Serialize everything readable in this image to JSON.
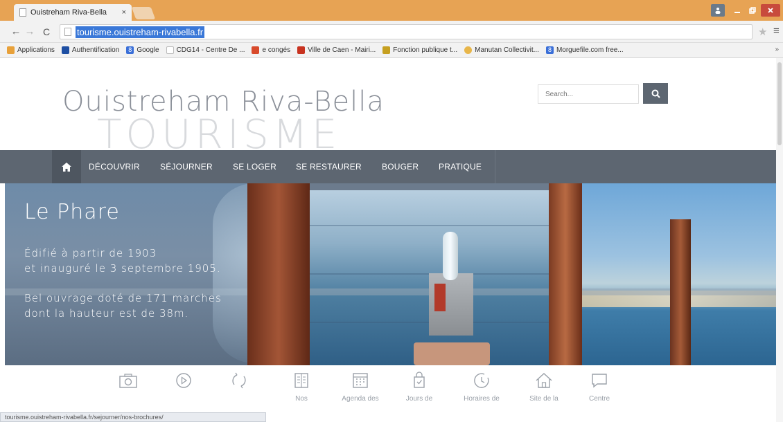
{
  "browser": {
    "tab_title": "Ouistreham Riva-Bella",
    "tab_close": "×",
    "url": "tourisme.ouistreham-rivabella.fr",
    "status_url": "tourisme.ouistreham-rivabella.fr/sejourner/nos-brochures/",
    "bookmarks": [
      {
        "label": "Applications",
        "icon": "apps-icon",
        "color": "#e8a13a"
      },
      {
        "label": "Authentification",
        "icon": "arrow-icon",
        "color": "#1e4fa3"
      },
      {
        "label": "Google",
        "icon": "google-icon",
        "color": "#3a6fd8"
      },
      {
        "label": "CDG14 - Centre De ...",
        "icon": "page-icon",
        "color": "#dddddd"
      },
      {
        "label": "e congés",
        "icon": "gem-icon",
        "color": "#d84a2b"
      },
      {
        "label": "Ville de Caen - Mairi...",
        "icon": "flame-icon",
        "color": "#c83320"
      },
      {
        "label": "Fonction publique t...",
        "icon": "g-icon",
        "color": "#c6a020"
      },
      {
        "label": "Manutan Collectivit...",
        "icon": "sun-icon",
        "color": "#e8b64a"
      },
      {
        "label": "Morguefile.com free...",
        "icon": "google-icon",
        "color": "#3a6fd8"
      }
    ],
    "bookmarks_more": "»"
  },
  "site": {
    "logo_line1": "Ouistreham Riva-Bella",
    "logo_line2": "TOURISME",
    "search_placeholder": "Search..."
  },
  "nav": {
    "items": [
      "DÉCOUVRIR",
      "SÉJOURNER",
      "SE LOGER",
      "SE RESTAURER",
      "BOUGER",
      "PRATIQUE"
    ]
  },
  "hero": {
    "title": "Le Phare",
    "line1": "Édifié à partir de 1903",
    "line2": "et inauguré le 3 septembre 1905.",
    "line3": "Bel ouvrage doté de 171 marches",
    "line4": "dont la hauteur est de 38m."
  },
  "shortcuts": [
    {
      "icon": "camera-icon",
      "label": ""
    },
    {
      "icon": "play-icon",
      "label": ""
    },
    {
      "icon": "refresh-icon",
      "label": ""
    },
    {
      "icon": "book-icon",
      "label": "Nos"
    },
    {
      "icon": "calendar-icon",
      "label": "Agenda des"
    },
    {
      "icon": "bag-icon",
      "label": "Jours de"
    },
    {
      "icon": "clock-icon",
      "label": "Horaires de"
    },
    {
      "icon": "home-icon",
      "label": "Site de la"
    },
    {
      "icon": "chat-icon",
      "label": "Centre"
    }
  ],
  "colors": {
    "nav_bg": "#5d6671",
    "tabstrip": "#e7a354",
    "url_highlight": "#3a78d8"
  }
}
